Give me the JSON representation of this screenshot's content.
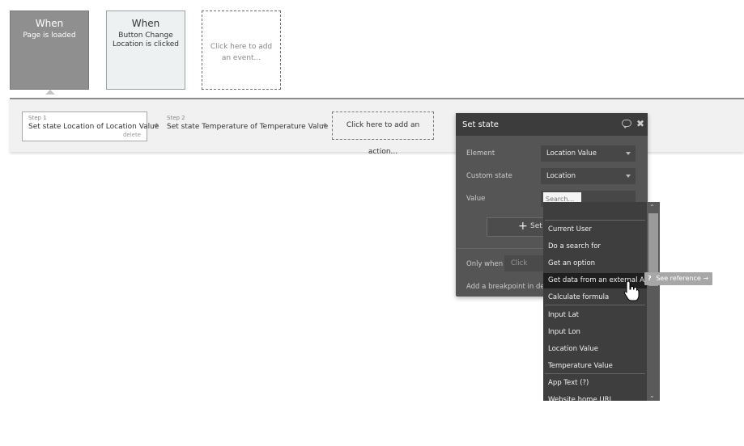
{
  "events": [
    {
      "when": "When",
      "label": "Page is loaded"
    },
    {
      "when": "When",
      "label": "Button Change Location is clicked"
    },
    {
      "when": "",
      "label": "Click here to add an event..."
    }
  ],
  "steps": [
    {
      "num": "Step 1",
      "title": "Set state Location of Location Value",
      "delete": "delete"
    },
    {
      "num": "Step 2",
      "title": "Set state Temperature of Temperature Value"
    }
  ],
  "add_action": "Click here to add an action...",
  "panel": {
    "title": "Set state",
    "element_label": "Element",
    "element_value": "Location Value",
    "custom_state_label": "Custom state",
    "custom_state_value": "Location",
    "value_label": "Value",
    "search_placeholder": "Search...",
    "set_button": "Set",
    "only_when_label": "Only when",
    "only_when_value": "Click",
    "breakpoint_label": "Add a breakpoint in deb"
  },
  "dropdown": {
    "items": [
      "Current User",
      "Do a search for",
      "Get an option",
      "Get data from an external API",
      "Calculate formula",
      "Input Lat",
      "Input Lon",
      "Location Value",
      "Temperature Value",
      "App Text (?)",
      "Website home URL"
    ],
    "highlighted": "Get data from an external API"
  },
  "see_reference": {
    "q": "?",
    "label": "See reference →"
  }
}
